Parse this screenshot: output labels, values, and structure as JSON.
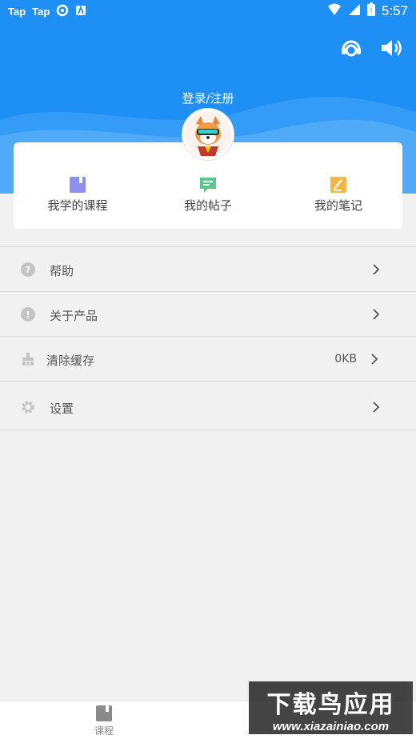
{
  "status_bar": {
    "app_labels": [
      "Tap",
      "Tap"
    ],
    "time": "5:57"
  },
  "header": {
    "login_label": "登录/注册"
  },
  "quick_links": [
    {
      "label": "我学的课程",
      "icon": "book-icon",
      "color": "#8f8ff0"
    },
    {
      "label": "我的帖子",
      "icon": "chat-icon",
      "color": "#5cc98a"
    },
    {
      "label": "我的笔记",
      "icon": "note-icon",
      "color": "#f8b444"
    }
  ],
  "menu": [
    {
      "label": "帮助",
      "icon": "help-icon",
      "value": ""
    },
    {
      "label": "关于产品",
      "icon": "info-icon",
      "value": ""
    },
    {
      "label": "清除缓存",
      "icon": "broom-icon",
      "value": "0KB"
    },
    {
      "label": "设置",
      "icon": "gear-icon",
      "value": ""
    }
  ],
  "bottom_nav": {
    "tab_label": "课程"
  },
  "watermark": {
    "title": "下载鸟应用",
    "url": "www.xiazainiao.com"
  },
  "colors": {
    "header_bg": "#1e90f5",
    "page_bg": "#f1f1f1"
  }
}
